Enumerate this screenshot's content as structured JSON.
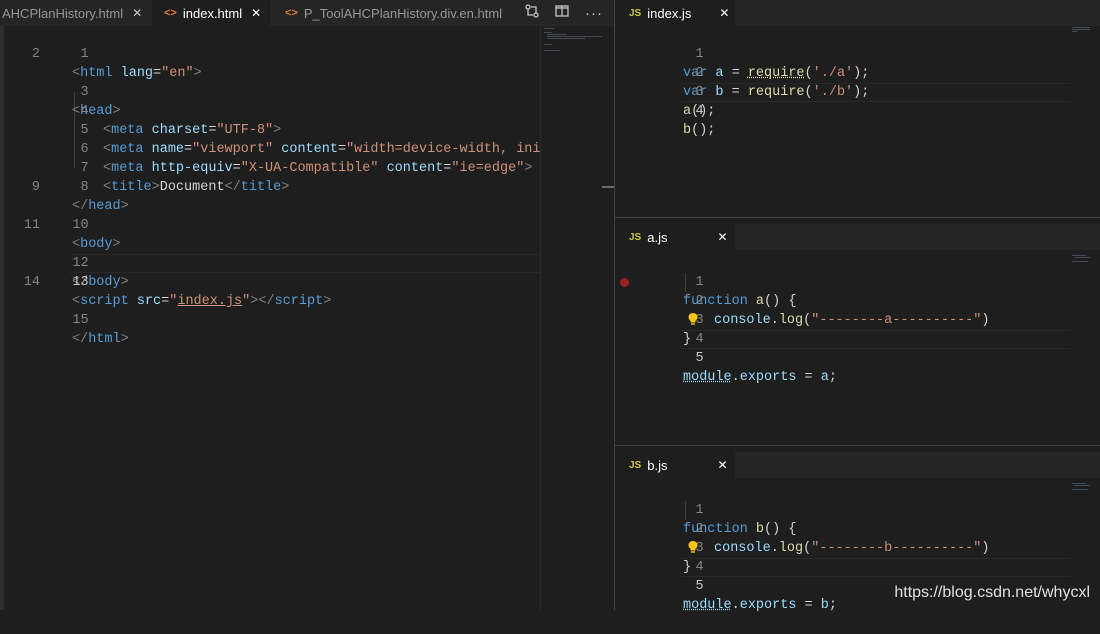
{
  "left": {
    "tabs": [
      {
        "label": "AHCPlanHistory.html",
        "icon": "html-icon",
        "active": false,
        "close": "✕"
      },
      {
        "label": "index.html",
        "icon": "html-icon",
        "active": true,
        "close": "✕"
      },
      {
        "label": "P_ToolAHCPlanHistory.div.en.html",
        "icon": "html-icon",
        "active": false
      }
    ],
    "actions": [
      "source-control-compare-icon",
      "split-editor-icon",
      "more-actions-icon"
    ],
    "lines": [
      {
        "n": "1"
      },
      {
        "n": "2"
      },
      {
        "n": "3"
      },
      {
        "n": "4"
      },
      {
        "n": "5"
      },
      {
        "n": "6"
      },
      {
        "n": "7"
      },
      {
        "n": "8"
      },
      {
        "n": "9"
      },
      {
        "n": "10"
      },
      {
        "n": "11"
      },
      {
        "n": "12"
      },
      {
        "n": "13"
      },
      {
        "n": "14"
      },
      {
        "n": "15"
      }
    ],
    "code": {
      "l1": [
        "<",
        "html",
        " lang",
        "=",
        "\"en\"",
        ">"
      ],
      "l3": [
        "<",
        "head",
        ">"
      ],
      "l4": [
        "<",
        "meta",
        " charset",
        "=",
        "\"UTF-8\"",
        ">"
      ],
      "l5": [
        "<",
        "meta",
        " name",
        "=",
        "\"viewport\"",
        " content",
        "=",
        "\"width=device-width, initia"
      ],
      "l6": [
        "<",
        "meta",
        " http-equiv",
        "=",
        "\"X-UA-Compatible\"",
        " content",
        "=",
        "\"ie=edge\"",
        ">"
      ],
      "l7": [
        "<",
        "title",
        ">",
        "Document",
        "</",
        "title",
        ">"
      ],
      "l8": [
        "</",
        "head",
        ">"
      ],
      "l10": [
        "<",
        "body",
        ">"
      ],
      "l12": [
        "</",
        "body",
        ">"
      ],
      "l13": [
        "<",
        "script",
        " src",
        "=",
        "\"",
        "index.js",
        "\"",
        "></",
        "script",
        ">"
      ],
      "l15": [
        "</",
        "html",
        ">"
      ]
    }
  },
  "right": {
    "panes": [
      {
        "tab": "index.js",
        "icon": "JS",
        "close": "✕",
        "lines": [
          {
            "n": "1"
          },
          {
            "n": "2"
          },
          {
            "n": "3"
          },
          {
            "n": "4"
          }
        ],
        "code": {
          "l1": [
            "var",
            " a",
            " = ",
            "require",
            "(",
            "'./a'",
            ");"
          ],
          "l2": [
            "var",
            " b",
            " = ",
            "require",
            "(",
            "'./b'",
            ");"
          ],
          "l3": [
            "a",
            "();"
          ],
          "l4": [
            "b",
            "();"
          ]
        }
      },
      {
        "tab": "a.js",
        "icon": "JS",
        "close": "✕",
        "lines": [
          {
            "n": "1"
          },
          {
            "n": "2"
          },
          {
            "n": "3"
          },
          {
            "n": "4"
          },
          {
            "n": "5"
          }
        ],
        "code": {
          "l1": [
            "function",
            " a",
            "() {"
          ],
          "l2": [
            "console",
            ".",
            "log",
            "(",
            "\"--------a----------\"",
            ")"
          ],
          "l3": [
            "}"
          ],
          "l5": [
            "module",
            ".",
            "exports",
            " = ",
            "a",
            ";"
          ]
        }
      },
      {
        "tab": "b.js",
        "icon": "JS",
        "close": "✕",
        "lines": [
          {
            "n": "1"
          },
          {
            "n": "2"
          },
          {
            "n": "3"
          },
          {
            "n": "4"
          },
          {
            "n": "5"
          }
        ],
        "code": {
          "l1": [
            "function",
            " b",
            "() {"
          ],
          "l2": [
            "console",
            ".",
            "log",
            "(",
            "\"--------b----------\"",
            ")"
          ],
          "l3": [
            "}"
          ],
          "l5": [
            "module",
            ".",
            "exports",
            " = ",
            "b",
            ";"
          ]
        }
      }
    ]
  },
  "watermark": "https://blog.csdn.net/whycxl",
  "colors": {
    "editor_bg": "#1e1e1e",
    "tabbar_bg": "#252526",
    "keyword": "#569cd6",
    "string": "#ce9178",
    "function": "#dcdcaa",
    "breakpoint": "#9b2020",
    "lightbulb": "#f5c518"
  }
}
